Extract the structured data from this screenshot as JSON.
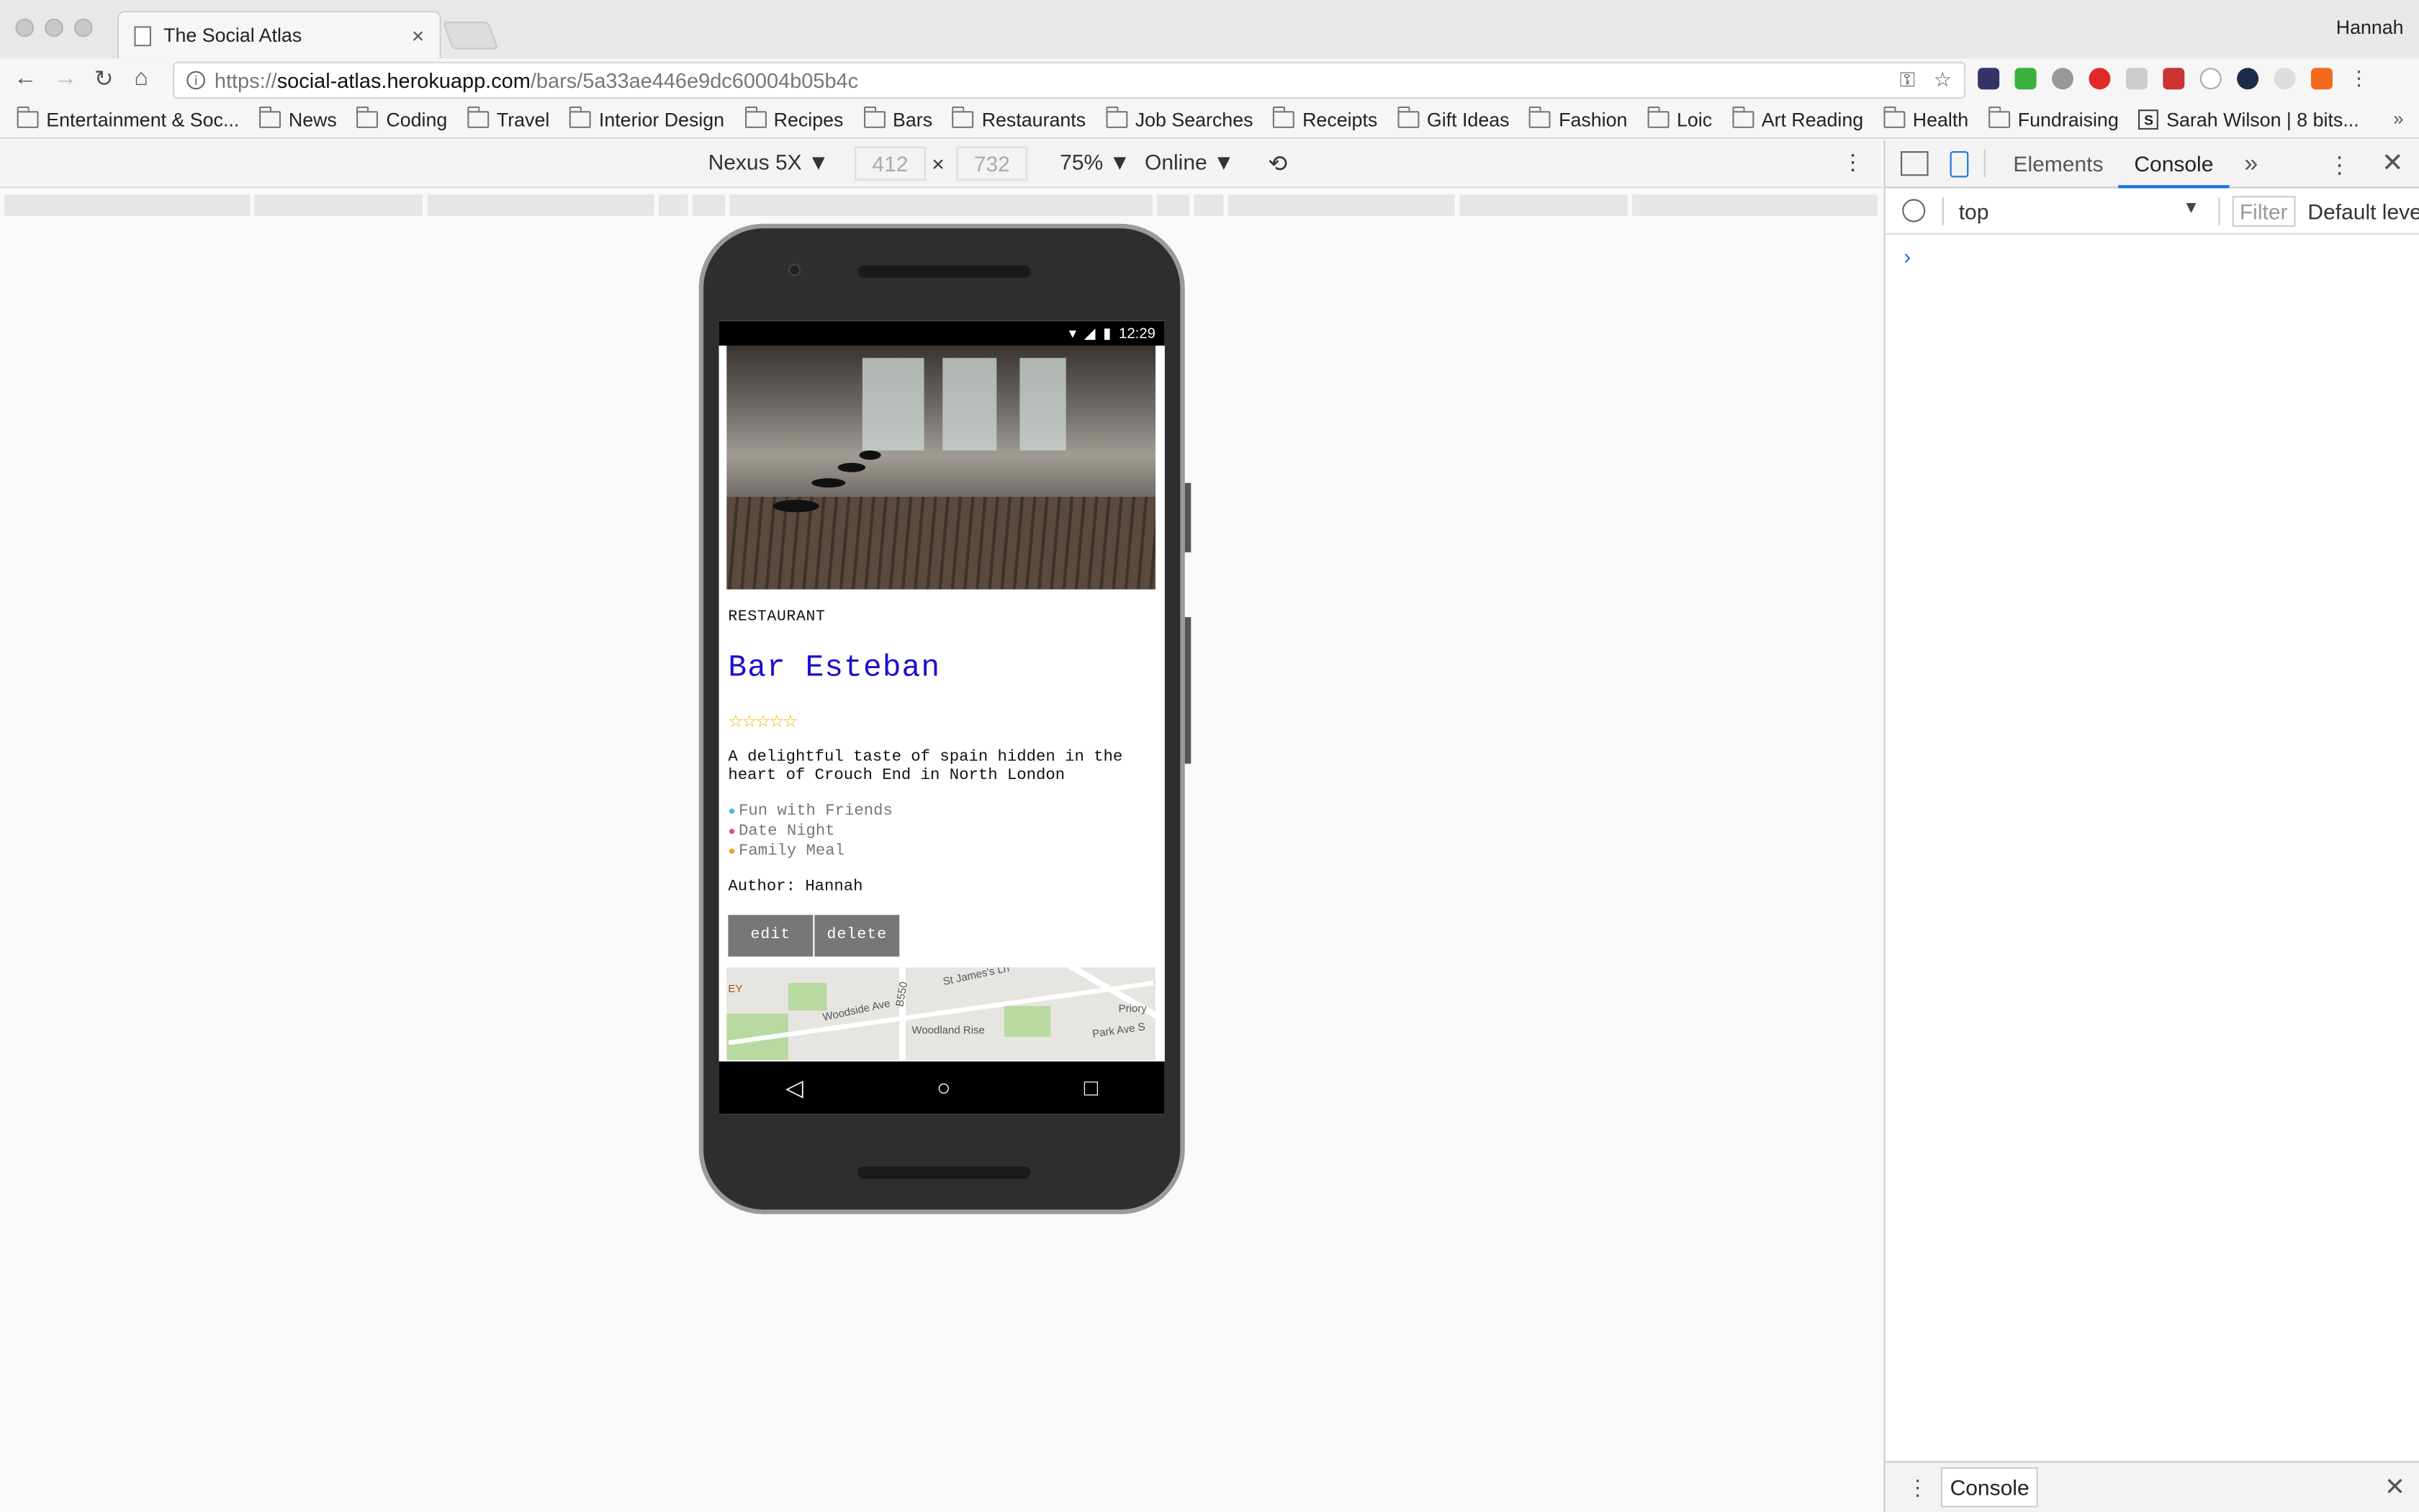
{
  "browser": {
    "tab_title": "The Social Atlas",
    "profile_name": "Hannah",
    "url_prefix": "https://",
    "url_host": "social-atlas.herokuapp.com",
    "url_path": "/bars/5a33ae446e9dc60004b05b4c",
    "bookmarks": [
      "Entertainment & Soc...",
      "News",
      "Coding",
      "Travel",
      "Interior Design",
      "Recipes",
      "Bars",
      "Restaurants",
      "Job Searches",
      "Receipts",
      "Gift Ideas",
      "Fashion",
      "Loic",
      "Art Reading",
      "Health",
      "Fundraising"
    ],
    "bookmark_special": "Sarah Wilson | 8 bits...",
    "bookmarks_more": "»"
  },
  "device_toolbar": {
    "device": "Nexus 5X ▼",
    "width": "412",
    "height": "732",
    "times": "×",
    "zoom": "75% ▼",
    "network": "Online ▼"
  },
  "phone": {
    "time": "12:29",
    "category": "RESTAURANT",
    "title": "Bar Esteban",
    "stars": "☆☆☆☆☆",
    "description": "A delightful taste of spain hidden in the heart of Crouch End in North London",
    "tags": [
      {
        "label": "Fun with Friends",
        "color": "#4db6e8"
      },
      {
        "label": "Date Night",
        "color": "#e84d8a"
      },
      {
        "label": "Family Meal",
        "color": "#f0a030"
      }
    ],
    "author": "Author: Hannah",
    "edit_label": "edit",
    "delete_label": "delete",
    "map_labels": {
      "a": "EY",
      "b": "Woodside Ave",
      "c": "B550",
      "d": "St James's Ln",
      "e": "Priory",
      "f": "Woodland Rise",
      "g": "Park Ave S"
    }
  },
  "devtools": {
    "tabs": [
      "Elements",
      "Console"
    ],
    "more": "»",
    "context": "top",
    "filter_placeholder": "Filter",
    "levels": "Default leve",
    "prompt": "›",
    "drawer_tab": "Console"
  }
}
